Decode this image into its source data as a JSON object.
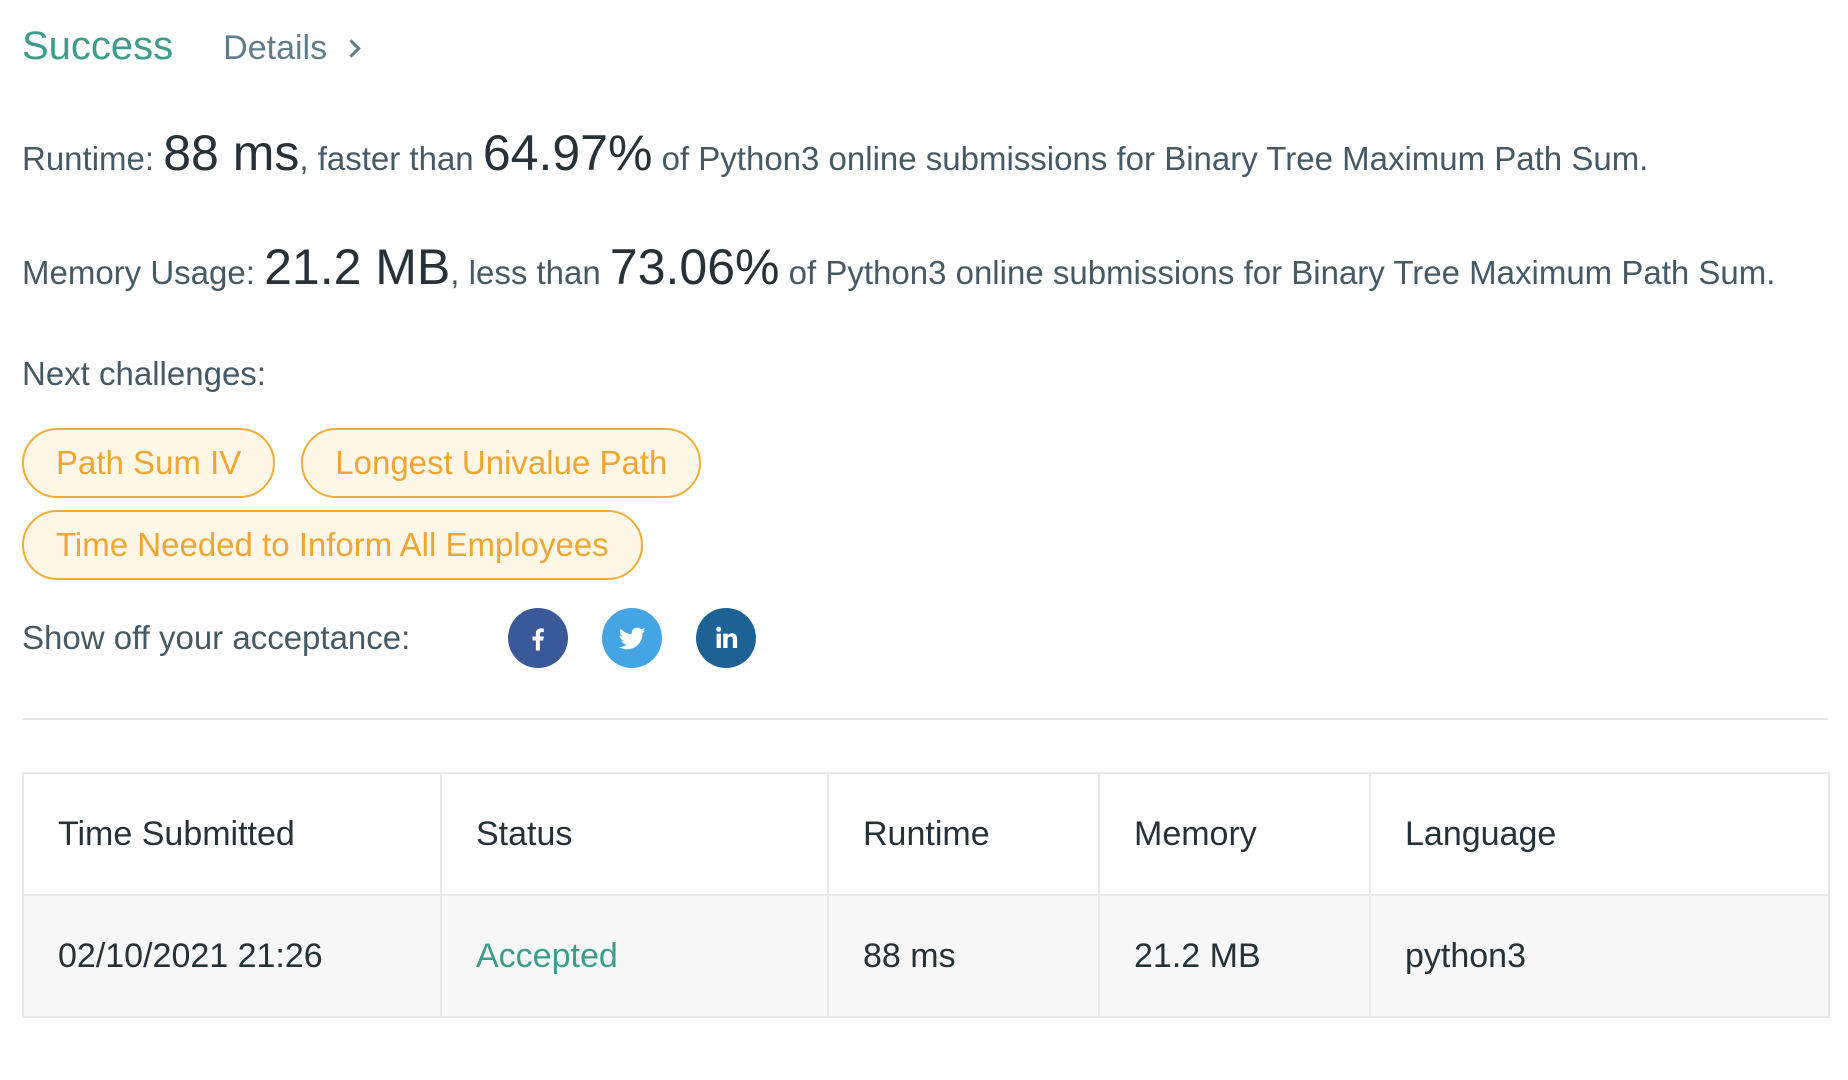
{
  "header": {
    "status": "Success",
    "details_label": "Details"
  },
  "runtime": {
    "label": "Runtime: ",
    "value": "88 ms",
    "mid": ", faster than ",
    "percent": "64.97%",
    "suffix": " of Python3 online submissions for Binary Tree Maximum Path Sum."
  },
  "memory": {
    "label": "Memory Usage: ",
    "value": "21.2 MB",
    "mid": ", less than ",
    "percent": "73.06%",
    "suffix": " of Python3 online submissions for Binary Tree Maximum Path Sum."
  },
  "next": {
    "label": "Next challenges:",
    "challenges": [
      "Path Sum IV",
      "Longest Univalue Path",
      "Time Needed to Inform All Employees"
    ]
  },
  "share": {
    "label": "Show off your acceptance:",
    "icons": [
      "facebook-icon",
      "twitter-icon",
      "linkedin-icon"
    ],
    "colors": {
      "facebook": "#3b5998",
      "twitter": "#45a5e4",
      "linkedin": "#1e6294"
    }
  },
  "table": {
    "headers": [
      "Time Submitted",
      "Status",
      "Runtime",
      "Memory",
      "Language"
    ],
    "rows": [
      [
        "02/10/2021 21:26",
        "Accepted",
        "88 ms",
        "21.2 MB",
        "python3"
      ]
    ]
  },
  "colors": {
    "success": "#3d9c8b",
    "chip_text": "#f0a630",
    "chip_border": "#f0ad39",
    "chip_bg": "#fff7e8"
  }
}
